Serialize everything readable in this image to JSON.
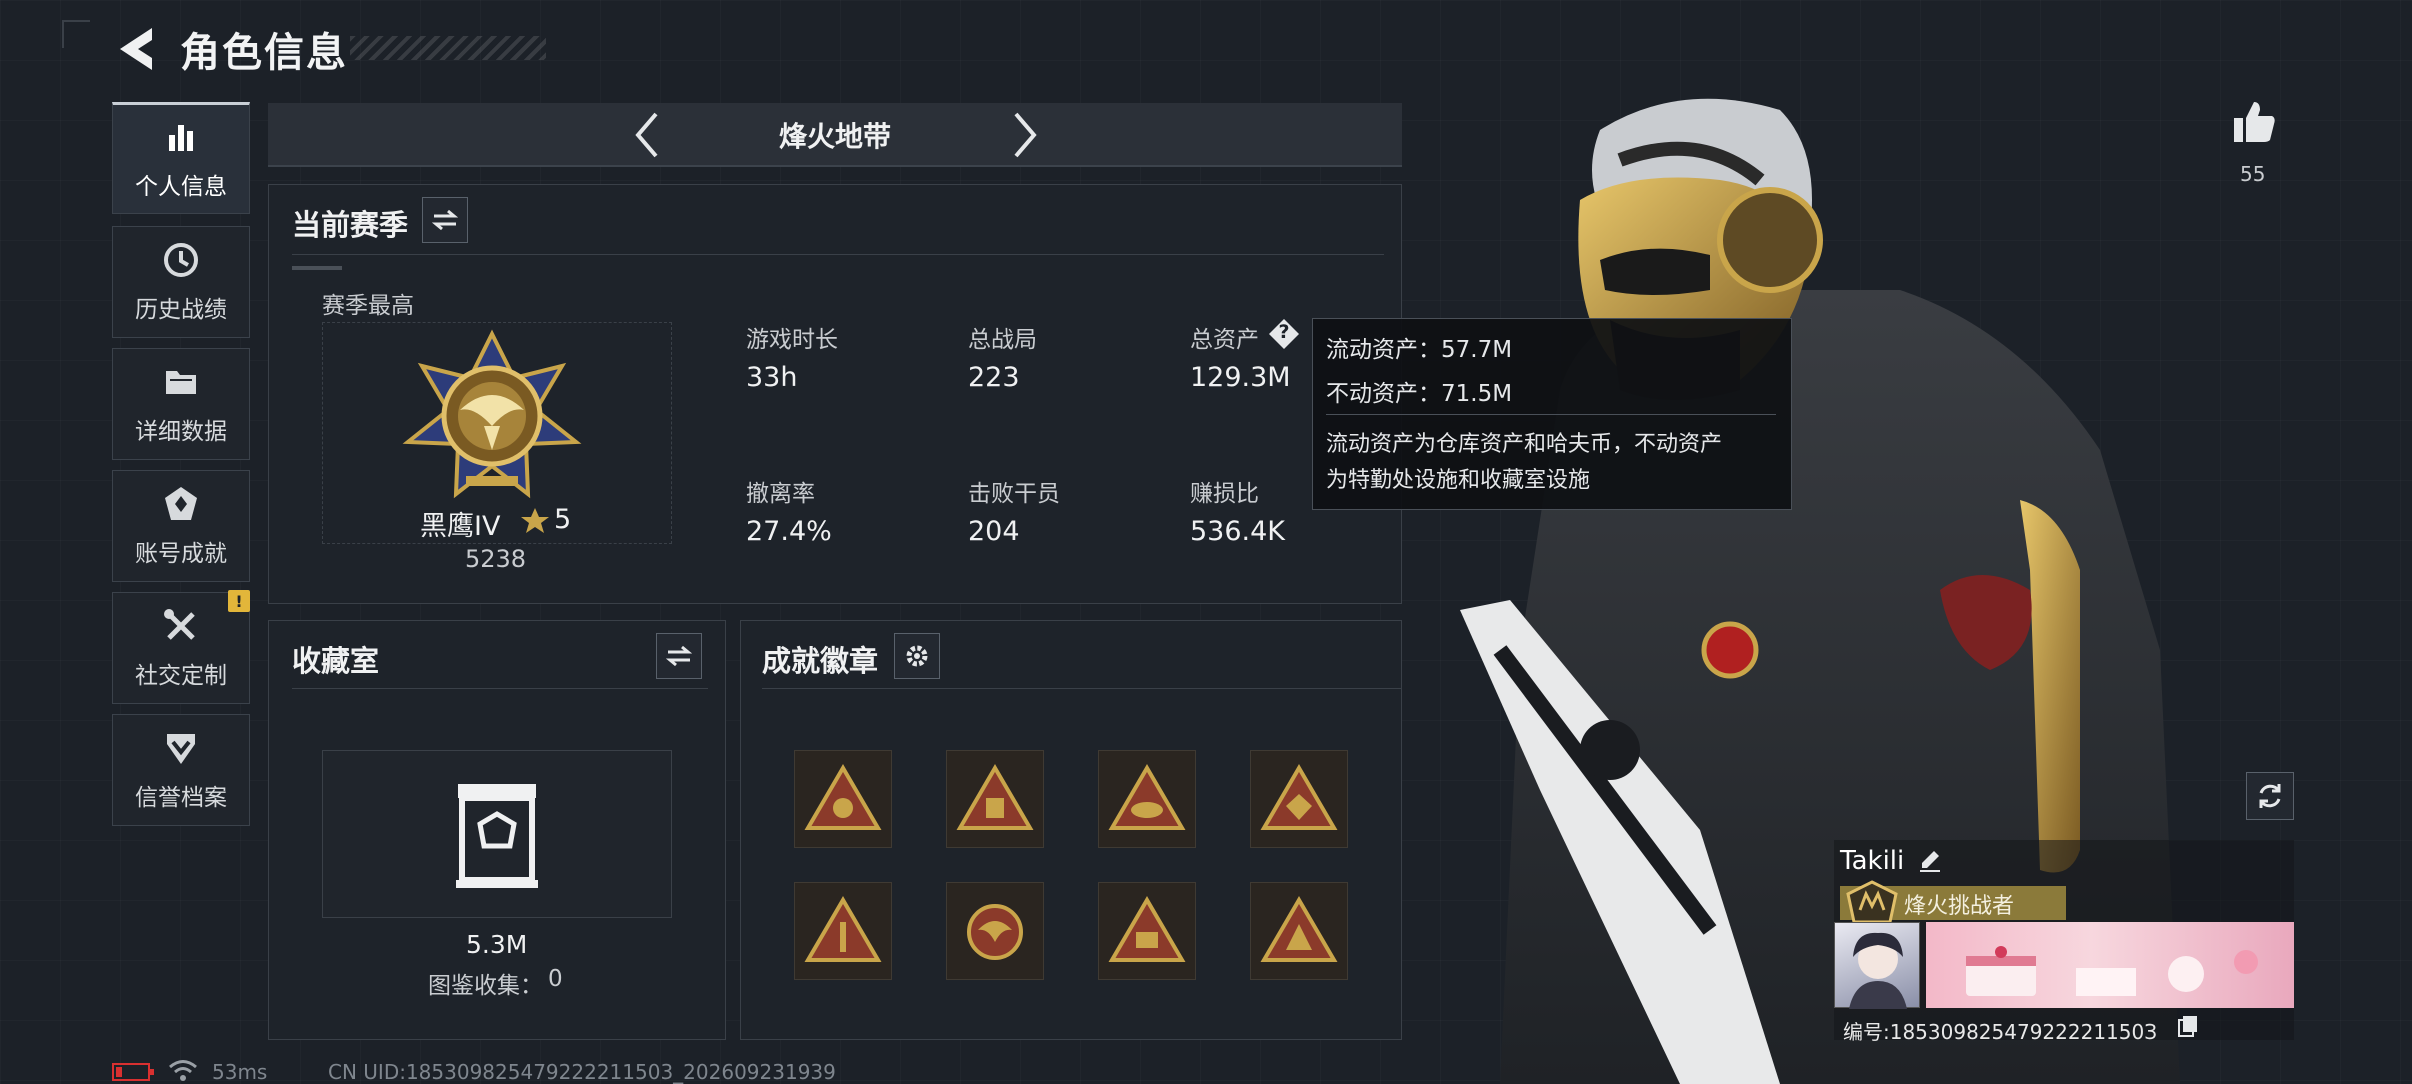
{
  "header": {
    "title": "角色信息"
  },
  "sidebar": {
    "items": [
      {
        "label": "个人信息",
        "icon": "bar-chart-icon",
        "active": true
      },
      {
        "label": "历史战绩",
        "icon": "history-icon",
        "active": false
      },
      {
        "label": "详细数据",
        "icon": "folder-icon",
        "active": false
      },
      {
        "label": "账号成就",
        "icon": "achievement-icon",
        "active": false
      },
      {
        "label": "社交定制",
        "icon": "tools-icon",
        "active": false,
        "badge": "!"
      },
      {
        "label": "信誉档案",
        "icon": "shield-chevron-icon",
        "active": false
      }
    ]
  },
  "mode": {
    "title": "烽火地带"
  },
  "season": {
    "title": "当前赛季",
    "best_label": "赛季最高",
    "rank_name": "黑鹰IV",
    "stars": "5",
    "rank_score": "5238",
    "stats": [
      {
        "label": "游戏时长",
        "value": "33h"
      },
      {
        "label": "总战局",
        "value": "223"
      },
      {
        "label": "总资产",
        "value": "129.3M",
        "info": "?"
      },
      {
        "label": "撤离率",
        "value": "27.4%"
      },
      {
        "label": "击败干员",
        "value": "204"
      },
      {
        "label": "赚损比",
        "value": "536.4K"
      }
    ]
  },
  "tooltip": {
    "liquid": "流动资产：57.7M",
    "fixed": "不动资产：71.5M",
    "note_line1": "流动资产为仓库资产和哈夫币，不动资产",
    "note_line2": "为特勤处设施和收藏室设施"
  },
  "collection": {
    "title": "收藏室",
    "value": "5.3M",
    "codex_label": "图鉴收集：",
    "codex_count": "0"
  },
  "achievements": {
    "title": "成就徽章",
    "badges": [
      "badge-icon",
      "badge-icon",
      "badge-icon",
      "badge-icon",
      "badge-icon",
      "badge-icon",
      "badge-icon",
      "badge-icon"
    ]
  },
  "likes": {
    "count": "55"
  },
  "profile": {
    "name": "Takili",
    "title": "烽火挑战者",
    "id_line": "编号:18530982547922221150З"
  },
  "status": {
    "ping": "53ms",
    "uid": "CN UID:185309825479222211503_202609231939"
  },
  "colors": {
    "accent_gold": "#c9a54a",
    "panel_bg": "#1e232a",
    "border": "#3a4048"
  }
}
